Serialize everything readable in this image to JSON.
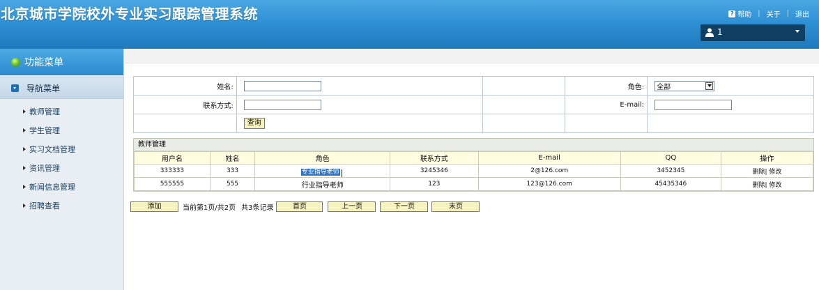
{
  "header": {
    "title": "北京城市学院校外专业实习跟踪管理系统",
    "links": {
      "help": "帮助",
      "about": "关于",
      "logout": "退出"
    },
    "user": "1"
  },
  "sidebar": {
    "menu_title": "功能菜单",
    "nav_title": "导航菜单",
    "items": [
      {
        "label": "教师管理"
      },
      {
        "label": "学生管理"
      },
      {
        "label": "实习文档管理"
      },
      {
        "label": "资讯管理"
      },
      {
        "label": "新闻信息管理"
      },
      {
        "label": "招聘查看"
      }
    ]
  },
  "search": {
    "name_label": "姓名:",
    "role_label": "角色:",
    "role_value": "全部",
    "contact_label": "联系方式:",
    "email_label": "E-mail:",
    "query_button": "查询"
  },
  "panel": {
    "title": "教师管理",
    "columns": [
      "用户名",
      "姓名",
      "角色",
      "联系方式",
      "E-mail",
      "QQ",
      "操作"
    ],
    "rows": [
      {
        "username": "333333",
        "name": "333",
        "role": "专业指导老师",
        "contact": "3245346",
        "email": "2@126.com",
        "qq": "3452345",
        "delete": "删除",
        "edit": "修改"
      },
      {
        "username": "555555",
        "name": "555",
        "role": "行业指导老师",
        "contact": "123",
        "email": "123@126.com",
        "qq": "45435346",
        "delete": "删除",
        "edit": "修改"
      }
    ]
  },
  "pager": {
    "add": "添加",
    "status": "当前第1页/共2页",
    "total": "共3条记录",
    "first": "首页",
    "prev": "上一页",
    "next": "下一页",
    "last": "末页"
  }
}
